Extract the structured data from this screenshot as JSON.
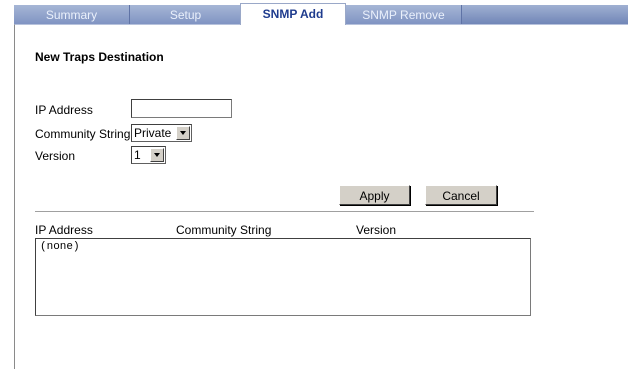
{
  "tabs": [
    {
      "label": "Summary",
      "active": false
    },
    {
      "label": "Setup",
      "active": false
    },
    {
      "label": "SNMP Add",
      "active": true
    },
    {
      "label": "SNMP Remove",
      "active": false
    }
  ],
  "form": {
    "heading": "New Traps Destination",
    "ip_label": "IP Address",
    "ip_value": "",
    "community_label": "Community String",
    "community_value": "Private",
    "version_label": "Version",
    "version_value": "1",
    "apply_label": "Apply",
    "cancel_label": "Cancel"
  },
  "table": {
    "columns": [
      "IP Address",
      "Community String",
      "Version"
    ],
    "rows": [
      "(none)"
    ]
  },
  "colors": {
    "tab_inactive": "#7e92c2",
    "tab_active_text": "#1f3c8e"
  }
}
